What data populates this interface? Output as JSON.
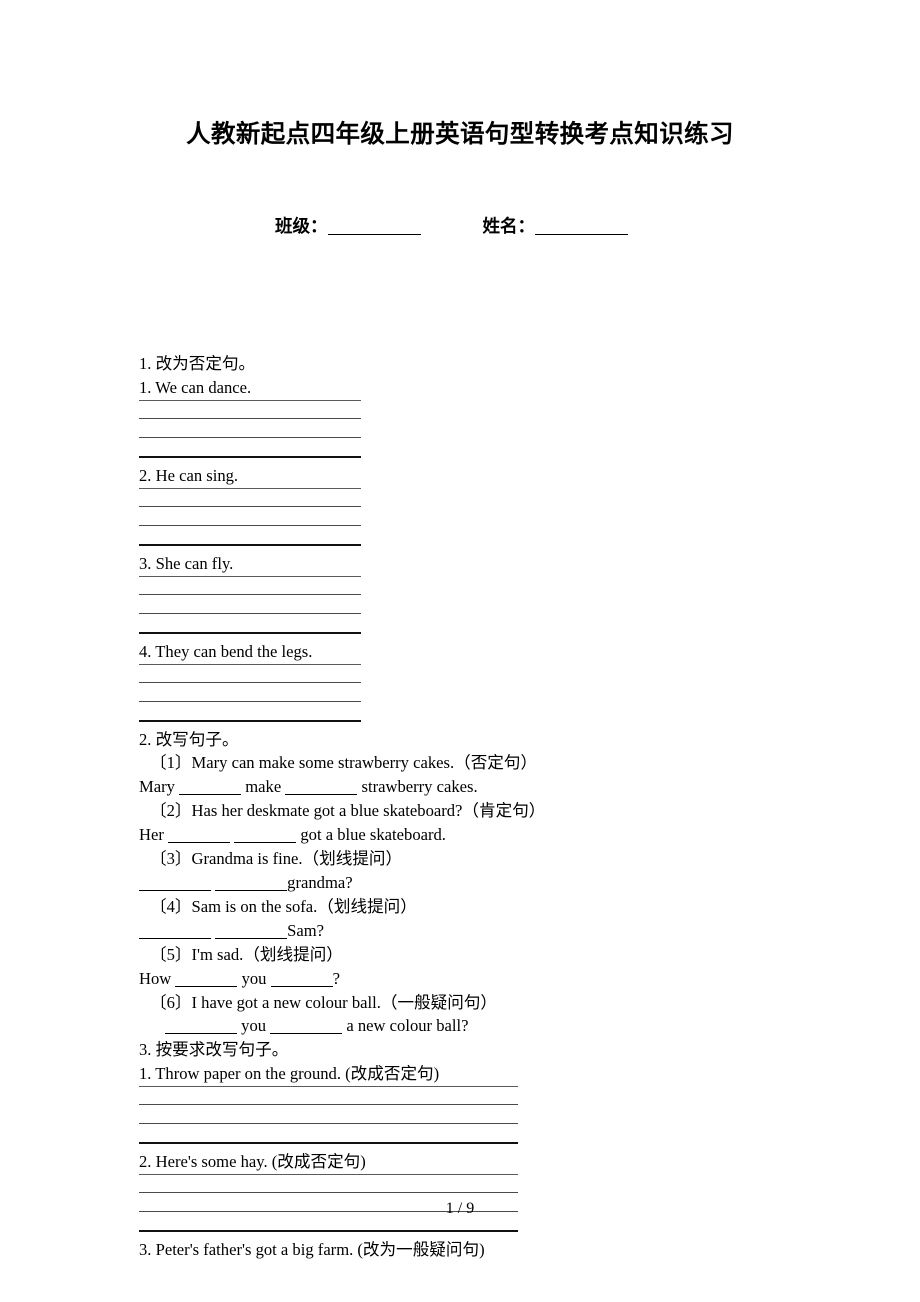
{
  "document": {
    "title": "人教新起点四年级上册英语句型转换考点知识练习",
    "header_fields": {
      "class_label": "班级：",
      "name_label": "姓名："
    },
    "footer": "1 / 9"
  },
  "sections": [
    {
      "heading": "1. 改为否定句。",
      "items": [
        {
          "prompt": "1. We can dance."
        },
        {
          "prompt": "2. He can sing."
        },
        {
          "prompt": "3. She can fly."
        },
        {
          "prompt": "4. They can bend the legs."
        }
      ]
    },
    {
      "heading": "2. 改写句子。",
      "items": [
        {
          "prompt": "〔1〕Mary can make some strawberry cakes.（否定句）",
          "answer_prefix": "Mary",
          "answer_mid": "make",
          "answer_suffix": "strawberry cakes."
        },
        {
          "prompt": "〔2〕Has her deskmate got a blue skateboard?（肯定句）",
          "answer_prefix": "Her",
          "answer_suffix": "got a blue skateboard."
        },
        {
          "prompt": "〔3〕Grandma is fine.（划线提问）",
          "answer_suffix": "grandma?"
        },
        {
          "prompt": "〔4〕Sam is on the sofa.（划线提问）",
          "answer_suffix": "Sam?"
        },
        {
          "prompt": "〔5〕I'm sad.（划线提问）",
          "answer_prefix": "How",
          "answer_mid": "you",
          "answer_suffix": "?"
        },
        {
          "prompt": "〔6〕I have got a new colour ball.（一般疑问句）",
          "answer_mid": "you",
          "answer_suffix": "a new colour ball?"
        }
      ]
    },
    {
      "heading": "3. 按要求改写句子。",
      "items": [
        {
          "prompt": "1. Throw paper on the ground.  (改成否定句)"
        },
        {
          "prompt": "2. Here's some hay.  (改成否定句)"
        },
        {
          "prompt": "3. Peter's father's got a big farm.  (改为一般疑问句)"
        }
      ]
    }
  ]
}
